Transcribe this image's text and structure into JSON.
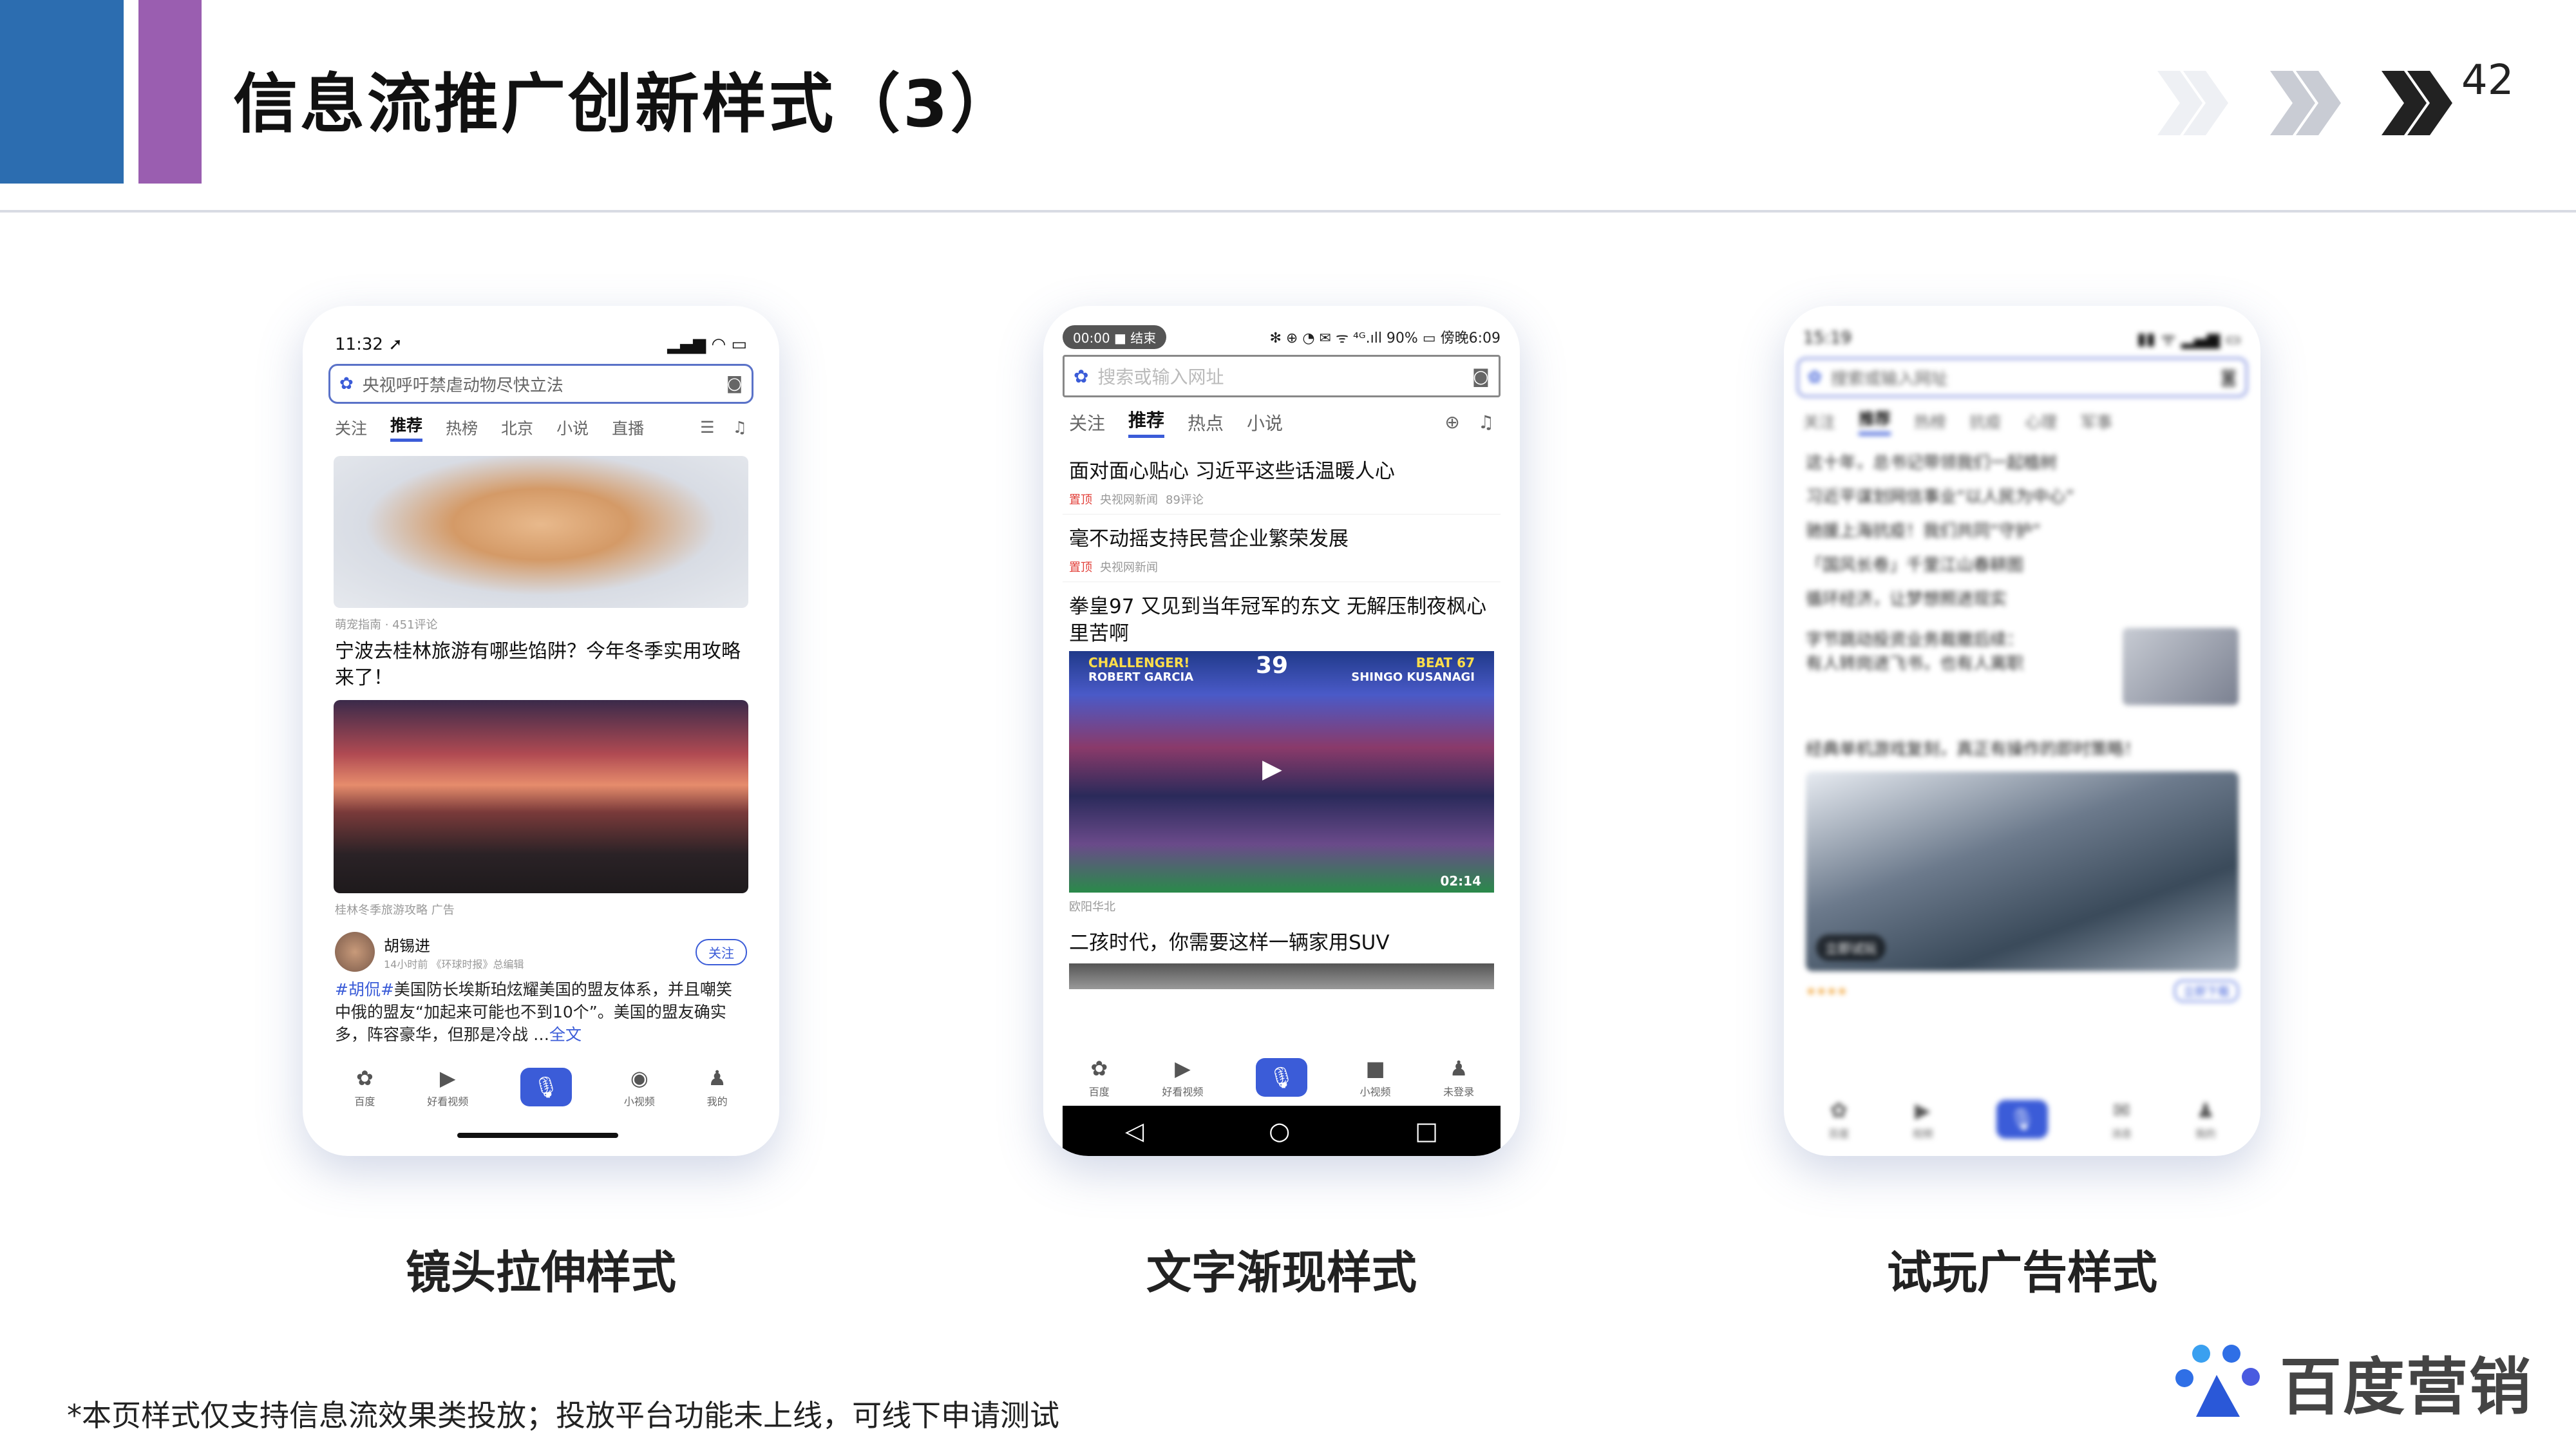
{
  "header": {
    "title": "信息流推广创新样式（3）",
    "page_number": "42",
    "colors": {
      "blue": "#2c6db0",
      "purple": "#9a5eb0"
    }
  },
  "phones": {
    "lens": {
      "status_time": "11:32 ➚",
      "search_placeholder": "央视呼吁禁虐动物尽快立法",
      "tabs": [
        "关注",
        "推荐",
        "热榜",
        "北京",
        "小说",
        "直播"
      ],
      "active_tab": "推荐",
      "item1_meta": "萌宠指南 · 451评论",
      "item2_title": "宁波去桂林旅游有哪些馅阱？今年冬季实用攻略来了！",
      "item2_meta": "桂林冬季旅游攻略  广告",
      "post_author": "胡锡进",
      "post_meta": "14小时前  《环球时报》总编辑",
      "follow_label": "关注",
      "post_tag": "#胡侃#",
      "post_text": "美国防长埃斯珀炫耀美国的盟友体系，并且嘲笑中俄的盟友“加起来可能也不到10个”。美国的盟友确实多，阵容豪华，但那是冷战 …",
      "post_more": "全文",
      "nav": [
        "百度",
        "好看视频",
        "",
        "小视频",
        "我的"
      ]
    },
    "text": {
      "rec_time": "00:00",
      "rec_end": "结束",
      "status_right": "✻ ⊕ ◔ ✉ ᯤ ⁴ᴳ.ıll 90% ▭ 傍晚6:09",
      "search_placeholder": "搜索或输入网址",
      "tabs": [
        "关注",
        "推荐",
        "热点",
        "小说"
      ],
      "active_tab": "推荐",
      "news": [
        {
          "title": "面对面心贴心 习近平这些话温暖人心",
          "tag": "置顶",
          "source": "央视网新闻",
          "comments": "89评论"
        },
        {
          "title": "毫不动摇支持民营企业繁荣发展",
          "tag": "置顶",
          "source": "央视网新闻",
          "comments": ""
        },
        {
          "title": "拳皇97 又见到当年冠军的东文 无解压制夜枫心里苦啊",
          "tag": "",
          "source": "欧阳华北",
          "comments": ""
        },
        {
          "title": "二孩时代，你需要这样一辆家用SUV",
          "tag": "",
          "source": "",
          "comments": ""
        }
      ],
      "game_labels": {
        "p1": "CHALLENGER!",
        "p2": "BEAT 67",
        "timer": "39",
        "left_name": "ROBERT GARCIA",
        "right_name": "SHINGO KUSANAGI",
        "time_left": "02:14"
      },
      "nav": [
        "百度",
        "好看视频",
        "",
        "小视频",
        "未登录"
      ],
      "android_nav": [
        "◁",
        "○",
        "□"
      ]
    },
    "play": {
      "status_time": "15:19",
      "search_placeholder": "搜索或输入网址",
      "tabs": [
        "关注",
        "推荐",
        "热榜",
        "抗疫",
        "心理",
        "军事"
      ],
      "active_tab": "推荐",
      "news": [
        "这十年，总书记带领我们一起植树",
        "习近平谋划网信事业“以人民为中心”",
        "驰援上海抗疫！我们共同“守护”",
        "「国风长卷」千里江山春耕图",
        "循环经济，让梦想照进现实"
      ],
      "article": "字节跳动投资业务裁撤后续：有人转岗进飞书，也有人离职",
      "game_title": "经典单机游戏复刻，真正有操作的即时策略！",
      "game_button": "立即试玩",
      "download_label": "立即下载",
      "nav": [
        "百度",
        "视频",
        "",
        "消息",
        "我的"
      ]
    }
  },
  "captions": [
    "镜头拉伸样式",
    "文字渐现样式",
    "试玩广告样式"
  ],
  "footnote": "*本页样式仅支持信息流效果类投放；投放平台功能未上线，可线下申请测试",
  "logo": {
    "text": "百度营销"
  }
}
